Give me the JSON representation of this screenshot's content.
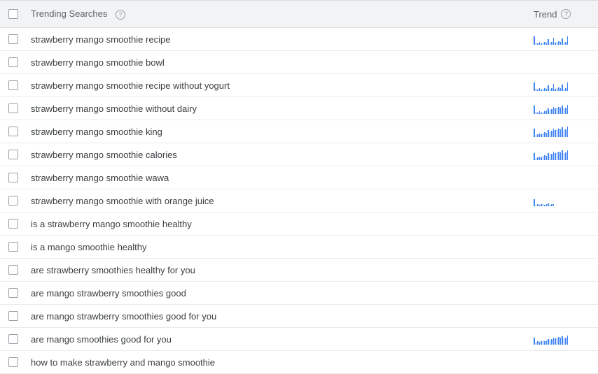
{
  "header": {
    "searches_label": "Trending Searches",
    "trend_label": "Trend"
  },
  "rows": [
    {
      "query": "strawberry mango smoothie recipe",
      "spark": [
        12,
        3,
        2,
        4,
        2,
        3,
        4,
        3,
        8,
        3,
        4,
        10,
        3,
        4,
        5,
        4,
        9,
        3,
        4,
        12
      ]
    },
    {
      "query": "strawberry mango smoothie bowl",
      "spark": null
    },
    {
      "query": "strawberry mango smoothie recipe without yogurt",
      "spark": [
        12,
        3,
        2,
        4,
        2,
        3,
        4,
        3,
        8,
        3,
        4,
        10,
        3,
        4,
        5,
        4,
        9,
        3,
        4,
        12
      ]
    },
    {
      "query": "strawberry mango smoothie without dairy",
      "spark": [
        12,
        3,
        2,
        4,
        2,
        3,
        4,
        5,
        8,
        6,
        7,
        10,
        8,
        9,
        10,
        9,
        12,
        8,
        9,
        13
      ]
    },
    {
      "query": "strawberry mango smoothie king",
      "spark": [
        12,
        3,
        4,
        5,
        4,
        6,
        7,
        6,
        10,
        8,
        9,
        12,
        10,
        11,
        12,
        11,
        14,
        10,
        11,
        15
      ]
    },
    {
      "query": "strawberry mango smoothie calories",
      "spark": [
        10,
        3,
        4,
        5,
        4,
        6,
        7,
        6,
        10,
        8,
        9,
        12,
        10,
        11,
        12,
        11,
        14,
        10,
        11,
        14
      ]
    },
    {
      "query": "strawberry mango smoothie wawa",
      "spark": null
    },
    {
      "query": "strawberry mango smoothie with orange juice",
      "spark": [
        10,
        2,
        3,
        2,
        3,
        3,
        2,
        3,
        4,
        2,
        3,
        3
      ]
    },
    {
      "query": "is a strawberry mango smoothie healthy",
      "spark": null
    },
    {
      "query": "is a mango smoothie healthy",
      "spark": null
    },
    {
      "query": "are strawberry smoothies healthy for you",
      "spark": null
    },
    {
      "query": "are mango strawberry smoothies good",
      "spark": null
    },
    {
      "query": "are mango strawberry smoothies good for you",
      "spark": null
    },
    {
      "query": "are mango smoothies good for you",
      "spark": [
        10,
        4,
        5,
        4,
        5,
        6,
        5,
        6,
        8,
        7,
        8,
        10,
        9,
        10,
        11,
        10,
        12,
        9,
        10,
        13
      ]
    },
    {
      "query": "how to make strawberry and mango smoothie",
      "spark": null
    }
  ]
}
